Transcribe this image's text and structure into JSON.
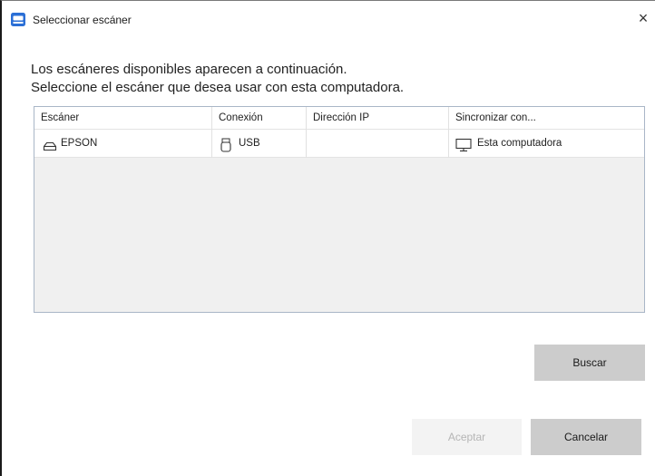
{
  "window": {
    "title": "Seleccionar escáner",
    "close_glyph": "×"
  },
  "instructions": {
    "line1": "Los escáneres disponibles aparecen a continuación.",
    "line2": "Seleccione el escáner que desea usar con esta computadora."
  },
  "table": {
    "columns": [
      "Escáner",
      "Conexión",
      "Dirección IP",
      "Sincronizar con..."
    ],
    "rows": [
      {
        "scanner": "EPSON",
        "scanner_icon": "scanner-icon",
        "connection": "USB",
        "connection_icon": "usb-icon",
        "ip": "",
        "sync": "Esta computadora",
        "sync_icon": "monitor-icon"
      }
    ]
  },
  "buttons": {
    "search": "Buscar",
    "accept": "Aceptar",
    "cancel": "Cancelar"
  },
  "colors": {
    "title_icon": "#2b6fd6",
    "button_bg": "#cccccc",
    "button_disabled_bg": "#f3f3f3",
    "table_border": "#a9b6c7"
  }
}
